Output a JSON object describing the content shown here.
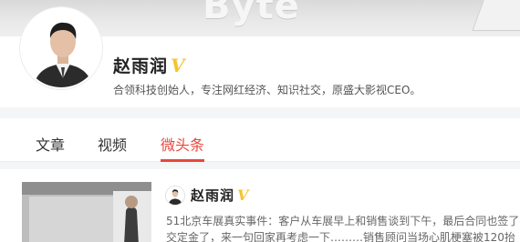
{
  "cover": {
    "watermark": "Byte"
  },
  "profile": {
    "name": "赵雨润",
    "verified_mark": "V",
    "bio": "合领科技创始人，专注网红经济、知识社交，原盛大影视CEO。"
  },
  "tabs": [
    {
      "label": "文章",
      "active": false
    },
    {
      "label": "视频",
      "active": false
    },
    {
      "label": "微头条",
      "active": true
    }
  ],
  "feed": {
    "post": {
      "author": "赵雨润",
      "verified_mark": "V",
      "line1": "51北京车展真实事件：客户从车展早上和销售谈到下午，最后合同也签了",
      "line2": "交定金了，来一句回家再考虑一下………销售顾问当场心肌梗塞被120抬"
    }
  },
  "colors": {
    "accent": "#e8473b",
    "verified": "#f4c430"
  }
}
